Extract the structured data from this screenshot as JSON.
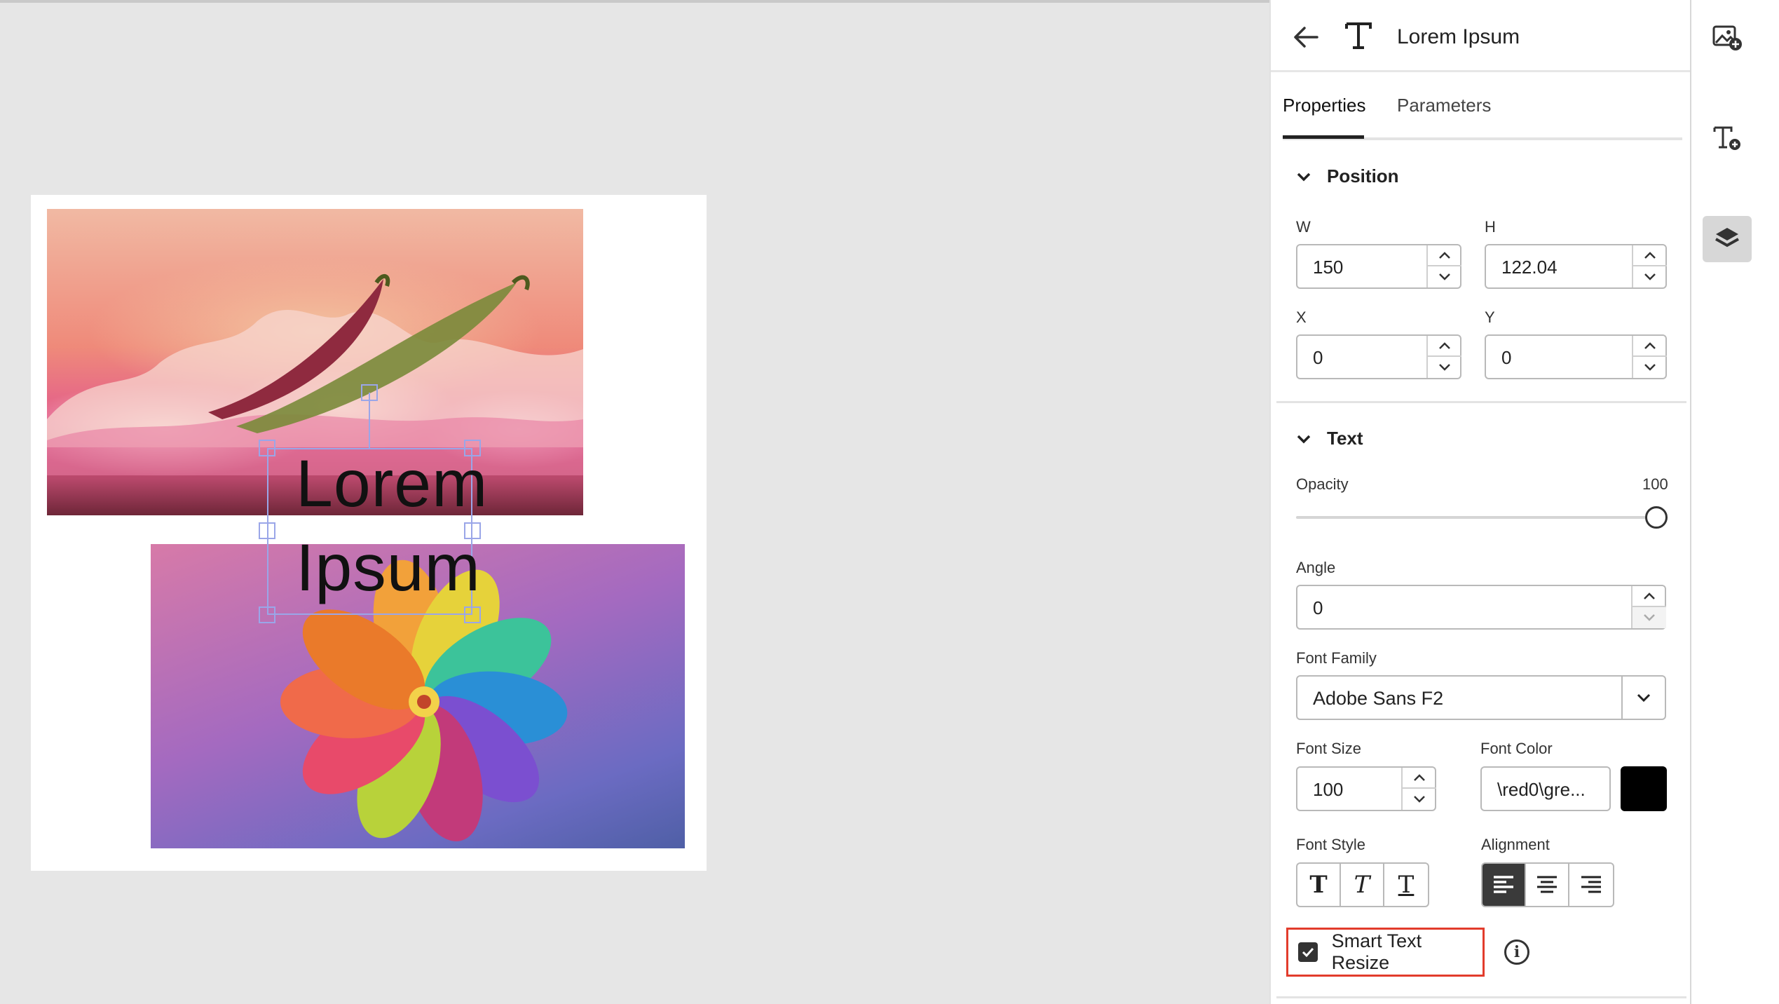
{
  "canvas": {
    "text_line1": "Lorem",
    "text_line2": "Ipsum",
    "image1_name": "pink-landscape-image",
    "image2_name": "rainbow-flower-image"
  },
  "panel": {
    "header_title": "Lorem Ipsum",
    "tabs": [
      {
        "label": "Properties",
        "active": true
      },
      {
        "label": "Parameters",
        "active": false
      }
    ],
    "position": {
      "heading": "Position",
      "w_label": "W",
      "w_value": "150",
      "h_label": "H",
      "h_value": "122.04",
      "x_label": "X",
      "x_value": "0",
      "y_label": "Y",
      "y_value": "0"
    },
    "text": {
      "heading": "Text",
      "opacity_label": "Opacity",
      "opacity_value": "100",
      "angle_label": "Angle",
      "angle_value": "0",
      "font_family_label": "Font Family",
      "font_family_value": "Adobe Sans F2",
      "font_size_label": "Font Size",
      "font_size_value": "100",
      "font_color_label": "Font Color",
      "font_color_value": "\\red0\\gre...",
      "font_color_swatch": "#000000",
      "font_style_label": "Font Style",
      "alignment_label": "Alignment",
      "alignment_selected": "left",
      "smart_resize_label": "Smart Text Resize",
      "smart_resize_checked": true
    }
  },
  "rail": {
    "icons": [
      "add-image-icon",
      "add-text-icon",
      "layers-icon"
    ],
    "active": "layers-icon"
  },
  "colors": {
    "accent_highlight": "#e23c2c",
    "selection": "#9aa6e8"
  }
}
